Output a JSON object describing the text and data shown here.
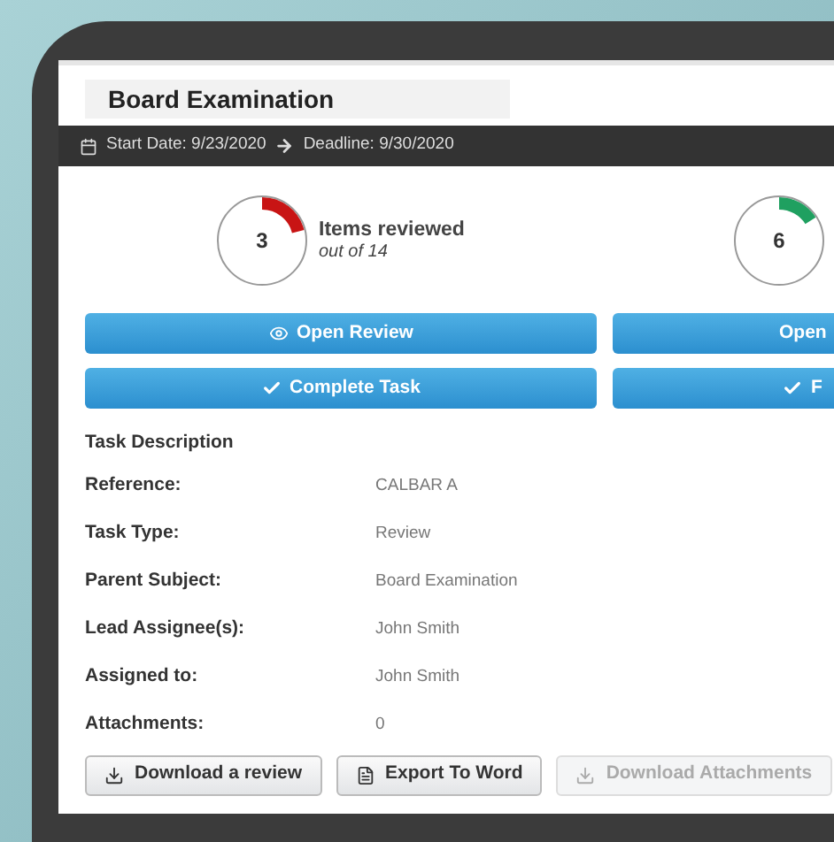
{
  "header": {
    "title": "Board Examination"
  },
  "date_bar": {
    "start": "Start Date: 9/23/2020",
    "deadline": "Deadline: 9/30/2020"
  },
  "stats": [
    {
      "value": "3",
      "label": "Items reviewed",
      "sublabel": "out of 14",
      "level": 0.21,
      "color": "#c81414"
    },
    {
      "value": "6",
      "level": 0.16,
      "color": "#1fa060"
    }
  ],
  "action_buttons": [
    {
      "label": "Open Review",
      "kind": "view"
    },
    {
      "label": "Open",
      "kind": "plain"
    },
    {
      "label": "Complete Task",
      "kind": "complete"
    },
    {
      "label": "F",
      "kind": "complete"
    }
  ],
  "task_description": {
    "heading": "Task Description",
    "fields": [
      {
        "label": "Reference:",
        "value": "CALBAR A"
      },
      {
        "label": "Task Type:",
        "value": "Review"
      },
      {
        "label": "Parent Subject:",
        "value": "Board Examination"
      },
      {
        "label": "Lead Assignee(s):",
        "value": "John Smith"
      },
      {
        "label": "Assigned to:",
        "value": "John Smith"
      },
      {
        "label": "Attachments:",
        "value": "0"
      }
    ]
  },
  "footer_buttons": [
    {
      "label": "Download a review",
      "kind": "download",
      "disabled": false
    },
    {
      "label": "Export To Word",
      "kind": "word",
      "disabled": false
    },
    {
      "label": "Download Attachments",
      "kind": "download",
      "disabled": true
    }
  ]
}
